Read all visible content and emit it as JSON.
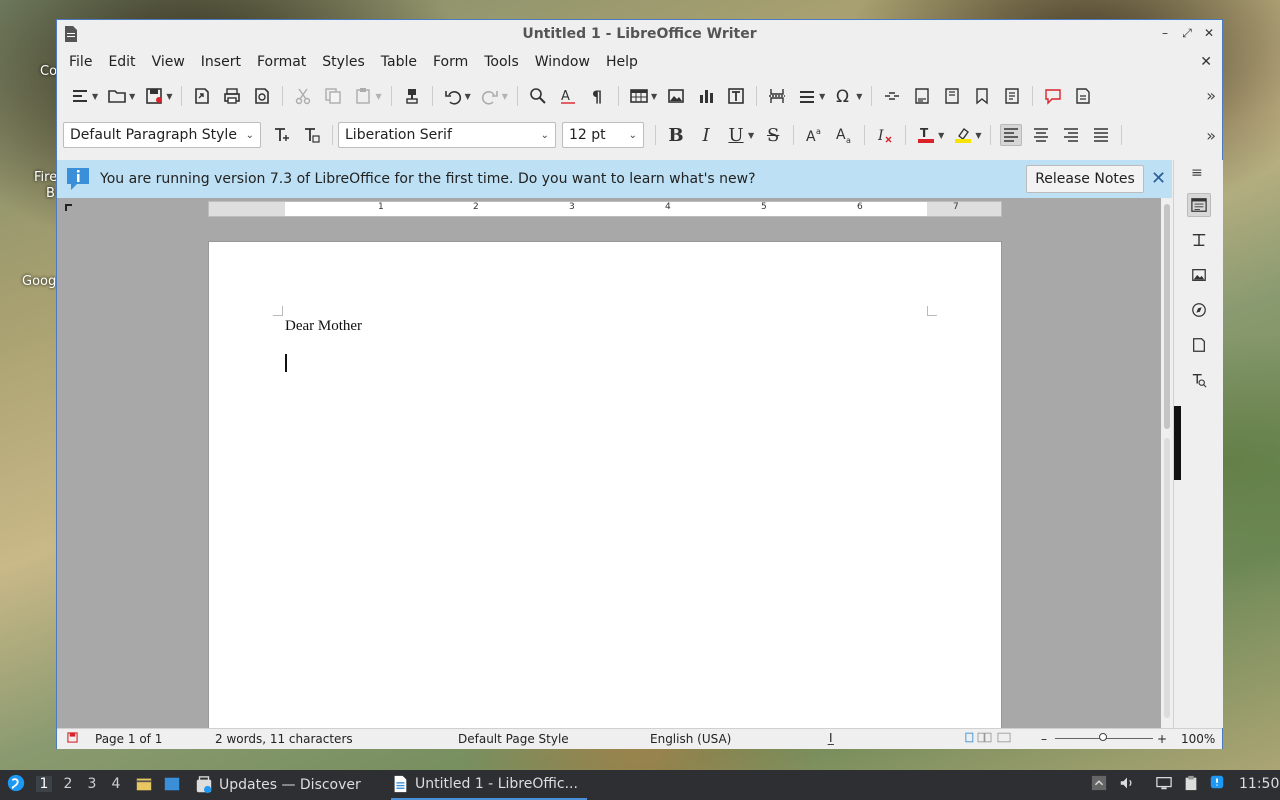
{
  "desktop": {
    "labels": [
      "Co",
      "Fire",
      "B",
      "Goog"
    ]
  },
  "window": {
    "title": "Untitled 1 - LibreOffice Writer",
    "controls": [
      "–",
      "⤢",
      "✕"
    ]
  },
  "menubar": {
    "items": [
      "File",
      "Edit",
      "View",
      "Insert",
      "Format",
      "Styles",
      "Table",
      "Form",
      "Tools",
      "Window",
      "Help"
    ],
    "close": "✕"
  },
  "formatting": {
    "paragraph_style": "Default Paragraph Style",
    "font_name": "Liberation Serif",
    "font_size": "12 pt",
    "bold": "B",
    "italic": "I",
    "underline": "U",
    "strike": "S",
    "font_color": "#d9232a",
    "highlight_color": "#f5e400"
  },
  "infobar": {
    "message": "You are running version 7.3 of LibreOffice for the first time. Do you want to learn what's new?",
    "button": "Release Notes",
    "close": "✕"
  },
  "ruler": {
    "numbers": [
      "1",
      "2",
      "3",
      "4",
      "5",
      "6",
      "7"
    ]
  },
  "document": {
    "text": "Dear Mother"
  },
  "statusbar": {
    "page": "Page 1 of 1",
    "words": "2 words, 11 characters",
    "page_style": "Default Page Style",
    "language": "English (USA)",
    "zoom": "100%",
    "zoom_minus": "–",
    "zoom_plus": "+"
  },
  "taskbar": {
    "workspaces": [
      "1",
      "2",
      "3",
      "4"
    ],
    "tasks": [
      "Updates — Discover",
      "Untitled 1 - LibreOffic..."
    ],
    "clock": "11:50"
  },
  "colors": {
    "accent": "#4a7bc0",
    "infobar_bg": "#bee0f4",
    "taskbar_bg": "#2d2f33"
  }
}
